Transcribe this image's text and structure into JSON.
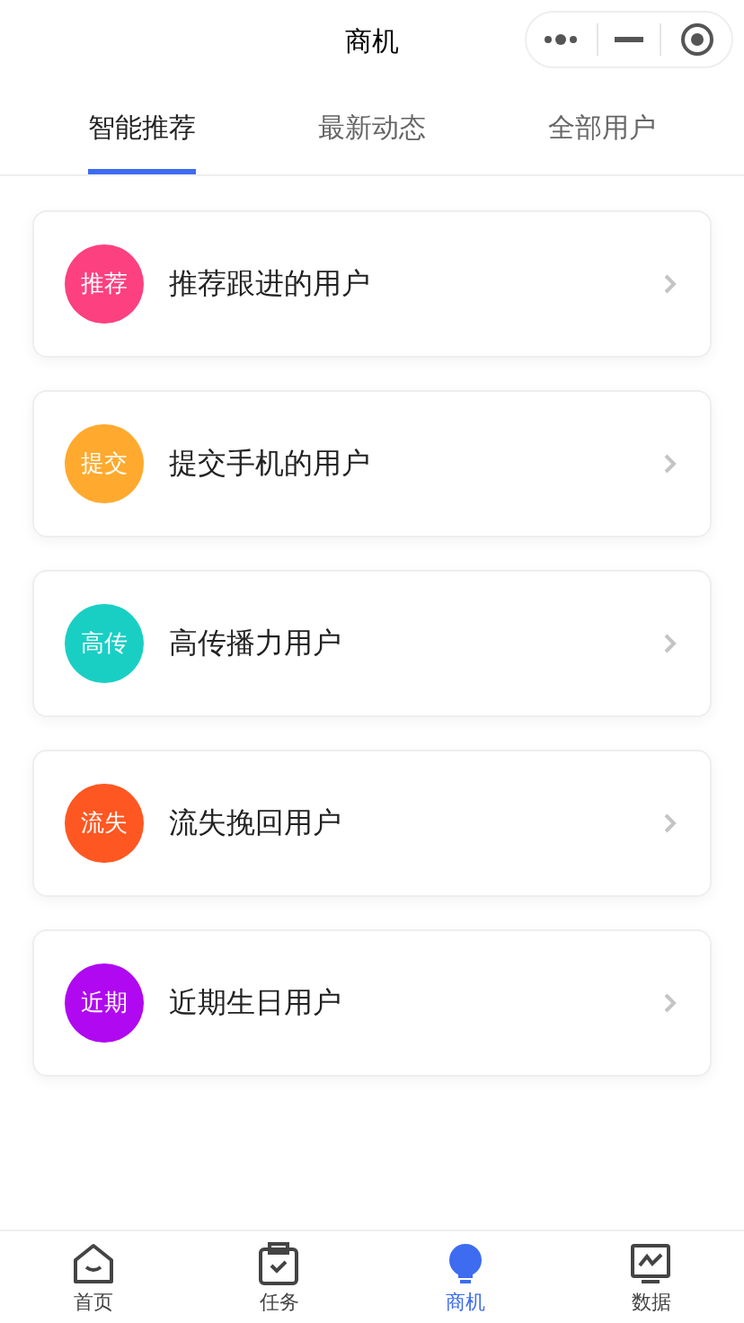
{
  "header": {
    "title": "商机"
  },
  "tabs": [
    {
      "label": "智能推荐",
      "selected": true
    },
    {
      "label": "最新动态",
      "selected": false
    },
    {
      "label": "全部用户",
      "selected": false
    }
  ],
  "cards": [
    {
      "badge": "推荐",
      "label": "推荐跟进的用户",
      "color": "#fc4080"
    },
    {
      "badge": "提交",
      "label": "提交手机的用户",
      "color": "#ffaa2e"
    },
    {
      "badge": "高传",
      "label": "高传播力用户",
      "color": "#19cfc4"
    },
    {
      "badge": "流失",
      "label": "流失挽回用户",
      "color": "#ff5722"
    },
    {
      "badge": "近期",
      "label": "近期生日用户",
      "color": "#b008f0"
    }
  ],
  "nav": [
    {
      "kind": "home",
      "label": "首页",
      "selected": false
    },
    {
      "kind": "task",
      "label": "任务",
      "selected": false
    },
    {
      "kind": "bulb",
      "label": "商机",
      "selected": true
    },
    {
      "kind": "chart",
      "label": "数据",
      "selected": false
    }
  ]
}
